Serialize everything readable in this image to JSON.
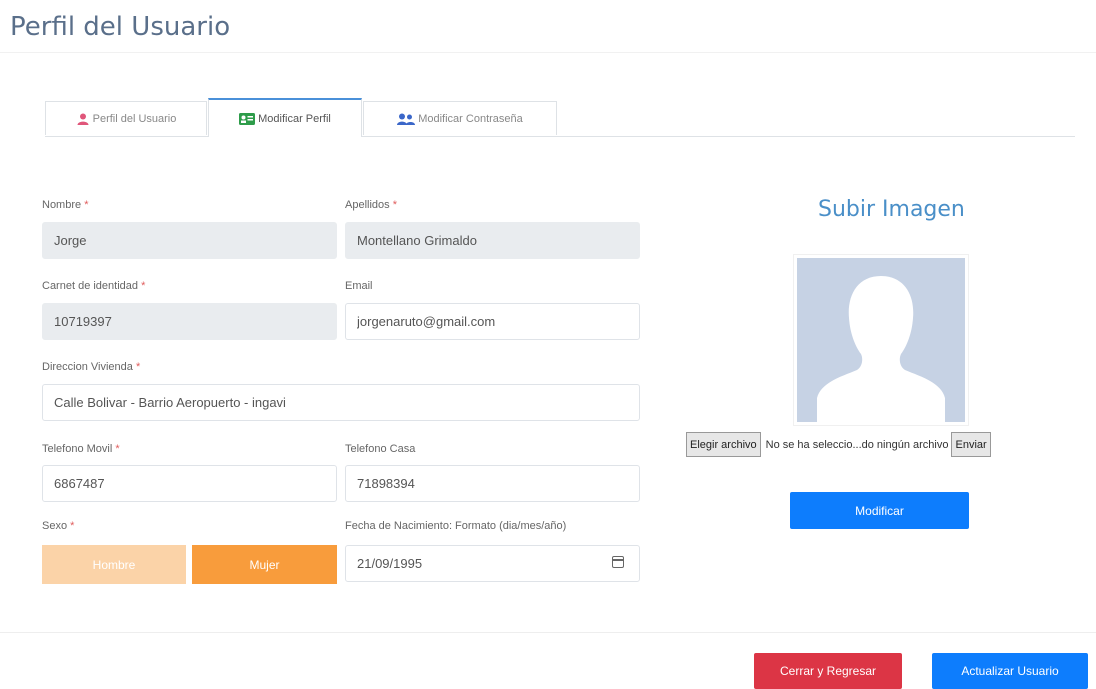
{
  "page": {
    "title": "Perfil del Usuario"
  },
  "tabs": [
    {
      "label": "Perfil del Usuario",
      "icon": "user-icon",
      "active": false
    },
    {
      "label": "Modificar Perfil",
      "icon": "id-card-icon",
      "active": true
    },
    {
      "label": "Modificar Contraseña",
      "icon": "users-icon",
      "active": false
    }
  ],
  "form": {
    "required_marker": "*",
    "nombre": {
      "label": "Nombre",
      "value": "Jorge"
    },
    "apellidos": {
      "label": "Apellidos",
      "value": "Montellano Grimaldo"
    },
    "carnet": {
      "label": "Carnet de identidad",
      "value": "10719397"
    },
    "email": {
      "label": "Email",
      "value": "jorgenaruto@gmail.com"
    },
    "direccion": {
      "label": "Direccion Vivienda",
      "value": "Calle Bolivar - Barrio Aeropuerto - ingavi"
    },
    "telefono_movil": {
      "label": "Telefono Movil",
      "value": "6867487"
    },
    "telefono_casa": {
      "label": "Telefono Casa",
      "value": "71898394"
    },
    "sexo": {
      "label": "Sexo",
      "options": [
        "Hombre",
        "Mujer"
      ],
      "selected": "Mujer"
    },
    "fecha_nacimiento": {
      "label": "Fecha de Nacimiento: Formato (dia/mes/año)",
      "value": "21/09/1995"
    }
  },
  "upload": {
    "title": "Subir Imagen",
    "choose_button": "Elegir archivo",
    "no_file_text": "No se ha seleccio...do ningún archivo",
    "send_button": "Enviar",
    "modify_button": "Modificar"
  },
  "footer": {
    "close_button": "Cerrar y Regresar",
    "update_button": "Actualizar Usuario"
  },
  "colors": {
    "accent": "#0d7dfd",
    "danger": "#dc3545",
    "selected_sexo": "#f89c3c",
    "unselected_sexo": "#fbd3a8",
    "required": "#e05c5c",
    "avatar_bg": "#c6d2e4"
  }
}
